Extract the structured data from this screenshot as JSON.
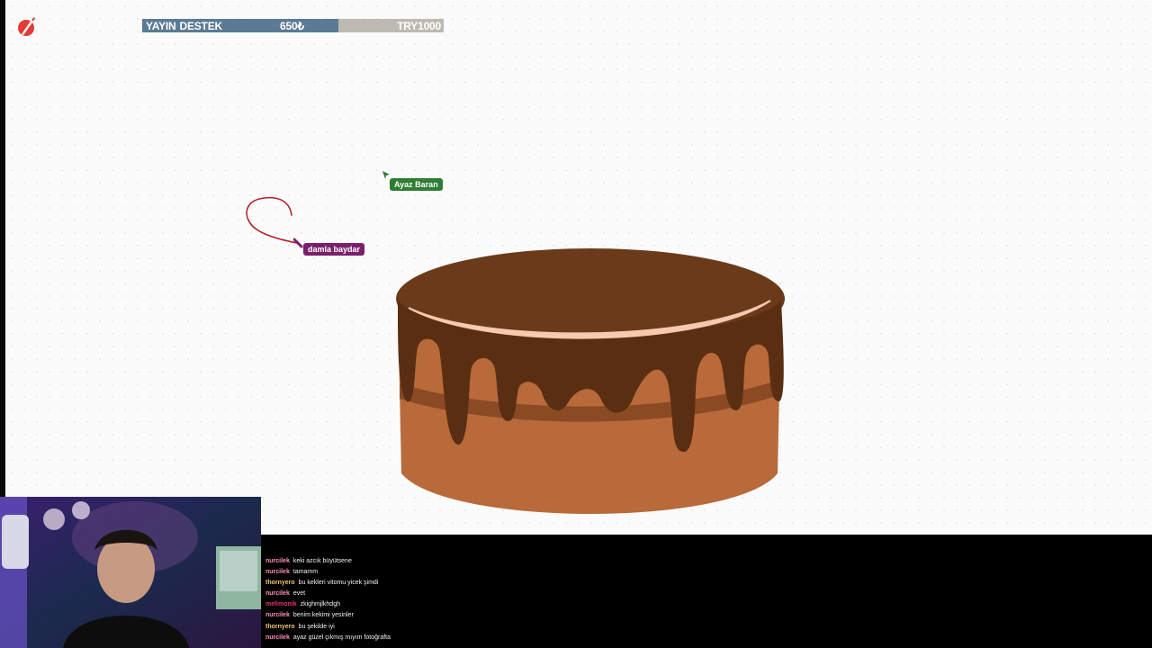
{
  "stream_overlay": {
    "donation_bar": {
      "label_part1": "YAYIN",
      "label_part2": "DESTEK",
      "amount": "650₺",
      "goal": "TRY1000",
      "progress": 0.65,
      "fill_color": "#5b7a93",
      "track_color": "#bdbab1"
    },
    "logo_icon": "pen-logo-icon"
  },
  "canvas": {
    "cursors": [
      {
        "name": "Ayaz Baran",
        "color": "#2e7d32"
      },
      {
        "name": "damla baydar",
        "color": "#7b1f6b"
      }
    ],
    "cake_colors": {
      "top": "#6b3a1a",
      "body": "#b86a3a",
      "drip": "#5a2e12",
      "shine": "#f6c9b0"
    }
  },
  "chat": {
    "messages": [
      {
        "user": "nurcilek",
        "user_color": "#ff8fb1",
        "text": "keki azcık büyütsene"
      },
      {
        "user": "nurcilek",
        "user_color": "#ff8fb1",
        "text": "tamamm"
      },
      {
        "user": "thornyero",
        "user_color": "#f0c36b",
        "text": "bu kekleri vitomu yicek şimdi"
      },
      {
        "user": "nurcilek",
        "user_color": "#ff8fb1",
        "text": "evet"
      },
      {
        "user": "melimonik",
        "user_color": "#e0336b",
        "text": "zkighmjlkhdgh"
      },
      {
        "user": "nurcilek",
        "user_color": "#ff8fb1",
        "text": "benim kekimi yesinler"
      },
      {
        "user": "thornyero",
        "user_color": "#f0c36b",
        "text": "bu şekilde iyi"
      },
      {
        "user": "nurcilek",
        "user_color": "#ff8fb1",
        "text": "ayaz güzel çıkmış mıyım fotoğrafta"
      }
    ]
  }
}
